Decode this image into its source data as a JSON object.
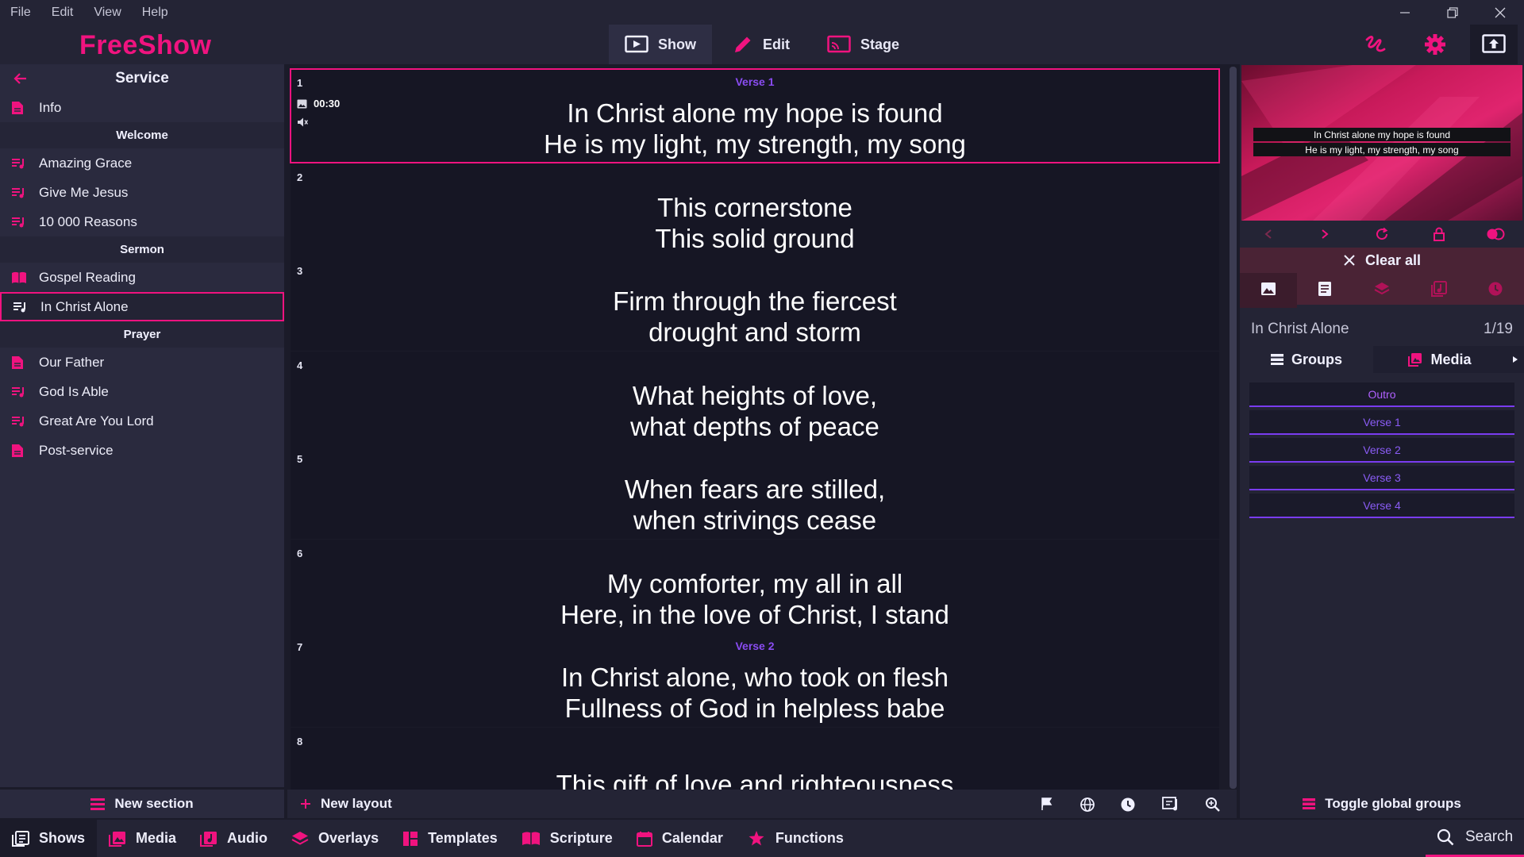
{
  "menu": [
    "File",
    "Edit",
    "View",
    "Help"
  ],
  "app": {
    "logo": "FreeShow"
  },
  "modes": [
    {
      "label": "Show",
      "icon": "show-icon",
      "active": true
    },
    {
      "label": "Edit",
      "icon": "edit-icon",
      "active": false
    },
    {
      "label": "Stage",
      "icon": "stage-icon",
      "active": false
    }
  ],
  "project": {
    "title": "Service",
    "items": [
      {
        "type": "item",
        "label": "Info",
        "icon": "document-icon"
      },
      {
        "type": "section",
        "label": "Welcome"
      },
      {
        "type": "item",
        "label": "Amazing Grace",
        "icon": "song-icon"
      },
      {
        "type": "item",
        "label": "Give Me Jesus",
        "icon": "song-icon"
      },
      {
        "type": "item",
        "label": "10 000 Reasons",
        "icon": "song-icon"
      },
      {
        "type": "section",
        "label": "Sermon"
      },
      {
        "type": "item",
        "label": "Gospel Reading",
        "icon": "bible-icon"
      },
      {
        "type": "item",
        "label": "In Christ Alone",
        "icon": "song-icon",
        "selected": true
      },
      {
        "type": "section",
        "label": "Prayer"
      },
      {
        "type": "item",
        "label": "Our Father",
        "icon": "document-icon"
      },
      {
        "type": "item",
        "label": "God Is Able",
        "icon": "song-icon"
      },
      {
        "type": "item",
        "label": "Great Are You Lord",
        "icon": "song-icon"
      },
      {
        "type": "item",
        "label": "Post-service",
        "icon": "document-icon"
      }
    ],
    "new_section": "New section"
  },
  "slides": [
    {
      "num": "1",
      "group": "Verse 1",
      "lines": [
        "In Christ alone my hope is found",
        "He is my light, my strength, my song"
      ],
      "timer": "00:30",
      "active": true
    },
    {
      "num": "2",
      "group": "",
      "lines": [
        "This cornerstone",
        "This solid ground"
      ]
    },
    {
      "num": "3",
      "group": "",
      "lines": [
        "Firm through the fiercest",
        "drought and storm"
      ]
    },
    {
      "num": "4",
      "group": "",
      "lines": [
        "What heights of love,",
        "what depths of peace"
      ]
    },
    {
      "num": "5",
      "group": "",
      "lines": [
        "When fears are stilled,",
        "when strivings cease"
      ]
    },
    {
      "num": "6",
      "group": "",
      "lines": [
        "My comforter, my all in all",
        "Here, in the love of Christ, I stand"
      ]
    },
    {
      "num": "7",
      "group": "Verse 2",
      "lines": [
        "In Christ alone, who took on flesh",
        "Fullness of God in helpless babe"
      ]
    },
    {
      "num": "8",
      "group": "",
      "lines": [
        "This gift of love and righteousness"
      ]
    }
  ],
  "center_footer": {
    "new_layout": "New layout"
  },
  "preview": {
    "lines": [
      "In Christ alone my hope is found",
      "He is my light, my strength, my song"
    ]
  },
  "clear": {
    "label": "Clear all"
  },
  "show_info": {
    "name": "In Christ Alone",
    "position": "1/19"
  },
  "right_tabs": [
    {
      "label": "Groups",
      "active": true
    },
    {
      "label": "Media",
      "active": false
    }
  ],
  "groups": [
    "Outro",
    "Verse 1",
    "Verse 2",
    "Verse 3",
    "Verse 4"
  ],
  "right_footer": {
    "toggle": "Toggle global groups"
  },
  "bottom_tabs": [
    {
      "label": "Shows",
      "active": true
    },
    {
      "label": "Media"
    },
    {
      "label": "Audio"
    },
    {
      "label": "Overlays"
    },
    {
      "label": "Templates"
    },
    {
      "label": "Scripture"
    },
    {
      "label": "Calendar"
    },
    {
      "label": "Functions"
    }
  ],
  "search": {
    "label": "Search"
  },
  "colors": {
    "accent": "#f0137f",
    "group": "#8a4cf2",
    "bg": "#1b1b29",
    "panel": "#242435"
  }
}
